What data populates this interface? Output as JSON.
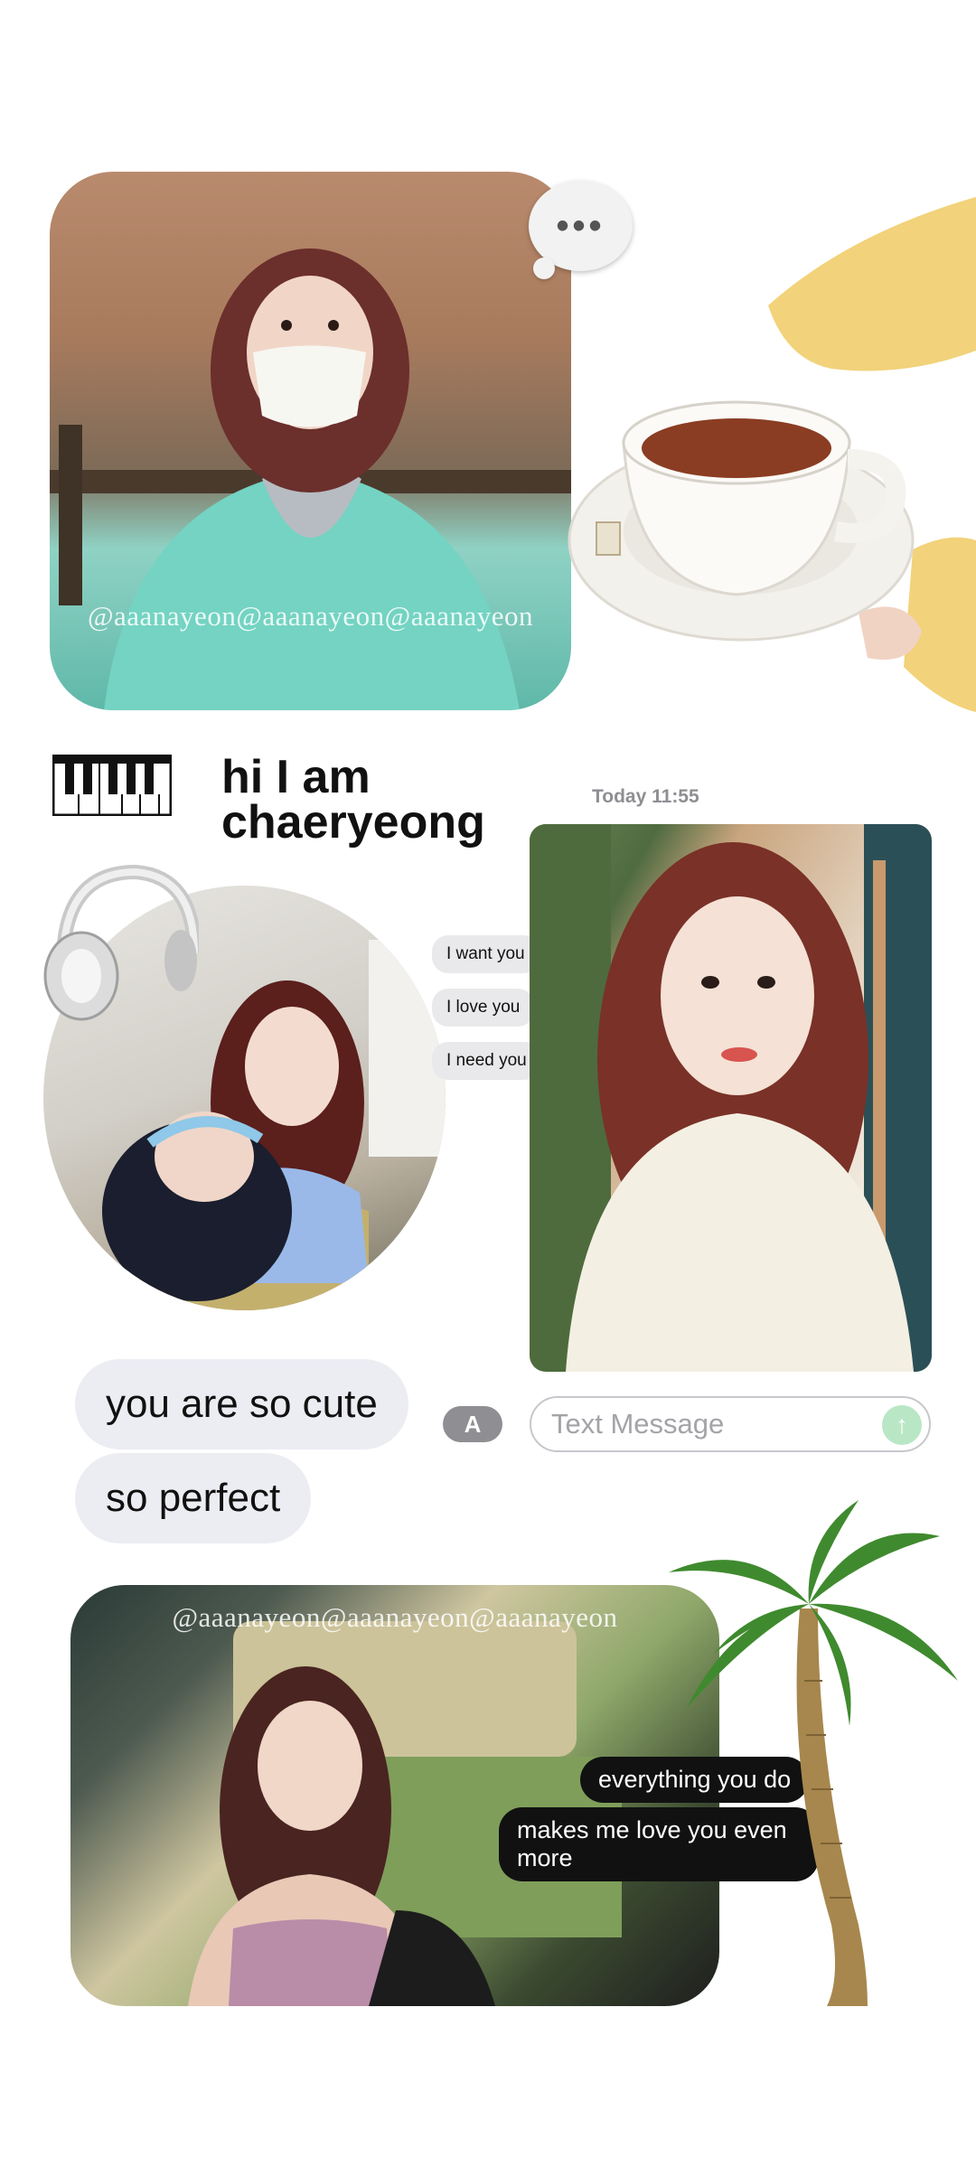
{
  "top": {
    "watermark": "@aaanayeon@aaanayeon@aaanayeon",
    "typing_indicator": "•••"
  },
  "intro": {
    "title": "hi I am chaeryeong",
    "timestamp": "Today 11:55"
  },
  "messages": {
    "small": [
      "I want you",
      "I love you",
      "I need you"
    ],
    "large": [
      "you are so cute",
      "so perfect"
    ],
    "black": [
      "everything you do",
      "makes me love you even more"
    ]
  },
  "composer": {
    "placeholder": "Text Message",
    "appstore_icon": "A",
    "send_icon": "↑"
  },
  "bottom": {
    "watermark": "@aaanayeon@aaanayeon@aaanayeon"
  },
  "icons": [
    "piano-icon",
    "headphones-icon",
    "palm-tree-icon",
    "teacup-icon",
    "appstore-icon",
    "send-arrow-icon"
  ]
}
